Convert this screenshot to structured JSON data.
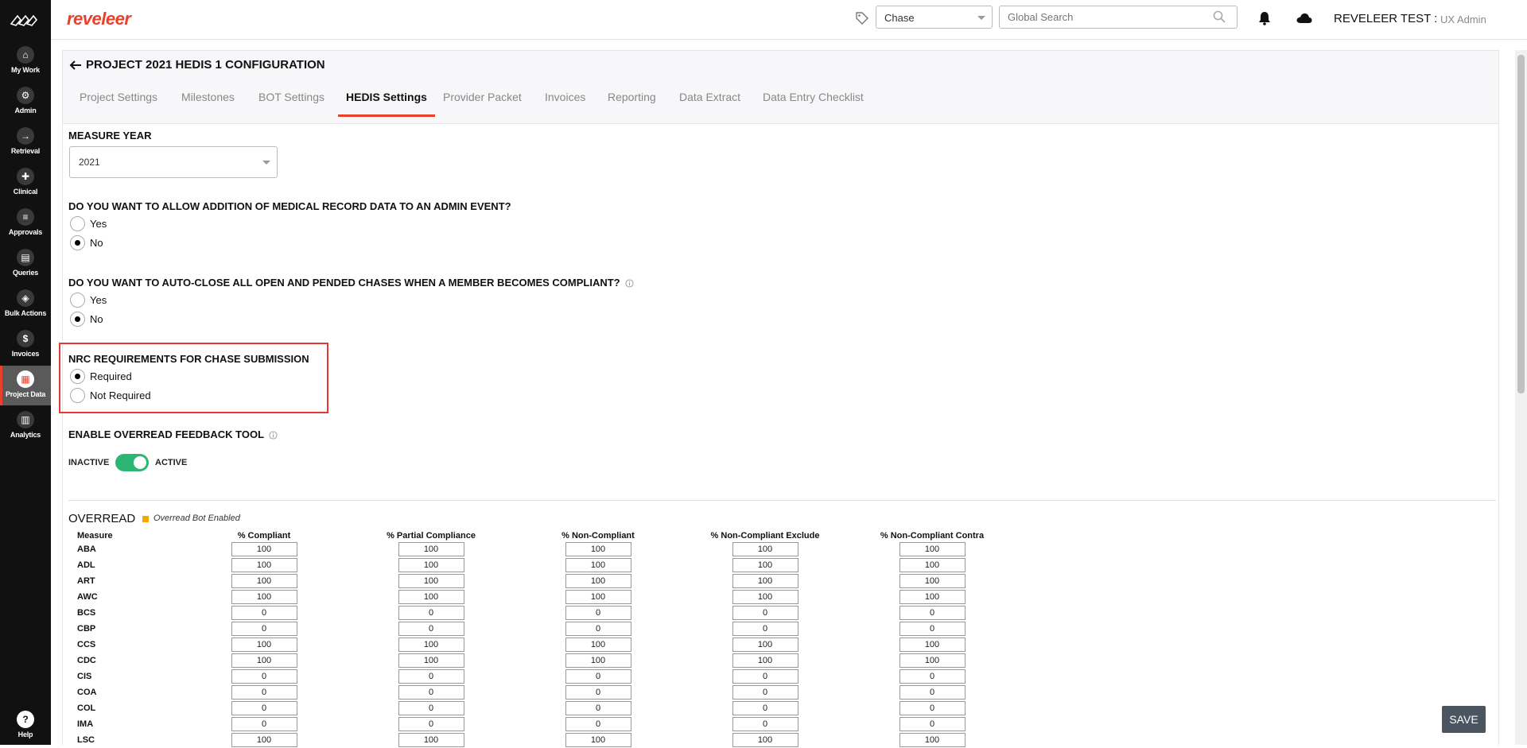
{
  "nav": {
    "items": [
      {
        "label": "My Work",
        "icon": "home-icon",
        "glyph": "⌂"
      },
      {
        "label": "Admin",
        "icon": "gear-icon",
        "glyph": "⚙"
      },
      {
        "label": "Retrieval",
        "icon": "arrow-in-icon",
        "glyph": "→"
      },
      {
        "label": "Clinical",
        "icon": "clipboard-icon",
        "glyph": "✚"
      },
      {
        "label": "Approvals",
        "icon": "list-icon",
        "glyph": "≡"
      },
      {
        "label": "Queries",
        "icon": "document-icon",
        "glyph": "▤"
      },
      {
        "label": "Bulk Actions",
        "icon": "layers-icon",
        "glyph": "◈"
      },
      {
        "label": "Invoices",
        "icon": "dollar-icon",
        "glyph": "$"
      },
      {
        "label": "Project Data",
        "icon": "grid-icon",
        "glyph": "▦"
      },
      {
        "label": "Analytics",
        "icon": "bar-chart-icon",
        "glyph": "▥"
      }
    ],
    "help": {
      "label": "Help",
      "glyph": "?"
    }
  },
  "topbar": {
    "brand": "reveleer",
    "chase_select": "Chase",
    "search_placeholder": "Global Search",
    "user_name": "REVELEER TEST :",
    "user_role": "UX Admin"
  },
  "page": {
    "title": "PROJECT 2021 HEDIS 1 CONFIGURATION",
    "tabs": [
      "Project Settings",
      "Milestones",
      "BOT Settings",
      "HEDIS Settings",
      "Provider Packet",
      "Invoices",
      "Reporting",
      "Data Extract",
      "Data Entry Checklist"
    ],
    "active_tab": "HEDIS Settings"
  },
  "settings": {
    "measure_year_label": "MEASURE YEAR",
    "measure_year_value": "2021",
    "q1_label": "DO YOU WANT TO ALLOW ADDITION OF MEDICAL RECORD DATA TO AN ADMIN EVENT?",
    "q1_yes": "Yes",
    "q1_no": "No",
    "q1_selected": "No",
    "q2_label": "DO YOU WANT TO AUTO-CLOSE ALL OPEN AND PENDED CHASES WHEN A MEMBER BECOMES COMPLIANT?",
    "q2_yes": "Yes",
    "q2_no": "No",
    "q2_selected": "No",
    "nrc_label": "NRC REQUIREMENTS FOR CHASE SUBMISSION",
    "nrc_required": "Required",
    "nrc_not_required": "Not Required",
    "nrc_selected": "Required",
    "overread_feedback_label": "ENABLE OVERREAD FEEDBACK TOOL",
    "toggle_inactive": "INACTIVE",
    "toggle_active": "ACTIVE",
    "toggle_state": "ACTIVE"
  },
  "overread": {
    "title": "OVERREAD",
    "bot_label": "Overread Bot Enabled",
    "bot_color": "#f4a800",
    "columns": [
      "Measure",
      "% Compliant",
      "% Partial Compliance",
      "% Non-Compliant",
      "% Non-Compliant Exclude",
      "% Non-Compliant Contra"
    ],
    "rows": [
      {
        "measure": "ABA",
        "values": [
          "100",
          "100",
          "100",
          "100",
          "100"
        ]
      },
      {
        "measure": "ADL",
        "values": [
          "100",
          "100",
          "100",
          "100",
          "100"
        ]
      },
      {
        "measure": "ART",
        "values": [
          "100",
          "100",
          "100",
          "100",
          "100"
        ]
      },
      {
        "measure": "AWC",
        "values": [
          "100",
          "100",
          "100",
          "100",
          "100"
        ]
      },
      {
        "measure": "BCS",
        "values": [
          "0",
          "0",
          "0",
          "0",
          "0"
        ]
      },
      {
        "measure": "CBP",
        "values": [
          "0",
          "0",
          "0",
          "0",
          "0"
        ]
      },
      {
        "measure": "CCS",
        "values": [
          "100",
          "100",
          "100",
          "100",
          "100"
        ]
      },
      {
        "measure": "CDC",
        "values": [
          "100",
          "100",
          "100",
          "100",
          "100"
        ]
      },
      {
        "measure": "CIS",
        "values": [
          "0",
          "0",
          "0",
          "0",
          "0"
        ]
      },
      {
        "measure": "COA",
        "values": [
          "0",
          "0",
          "0",
          "0",
          "0"
        ]
      },
      {
        "measure": "COL",
        "values": [
          "0",
          "0",
          "0",
          "0",
          "0"
        ]
      },
      {
        "measure": "IMA",
        "values": [
          "0",
          "0",
          "0",
          "0",
          "0"
        ]
      },
      {
        "measure": "LSC",
        "values": [
          "100",
          "100",
          "100",
          "100",
          "100"
        ]
      }
    ]
  },
  "save_label": "SAVE",
  "colors": {
    "brand": "#e8402b",
    "toggle_on": "#2bb673",
    "highlight": "#e53935"
  }
}
